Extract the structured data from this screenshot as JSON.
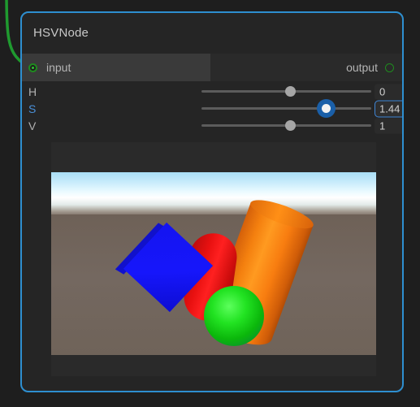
{
  "node": {
    "title": "HSVNode",
    "border_color": "#2e8fd0",
    "background": "#252525",
    "ports": {
      "input": {
        "label": "input",
        "icon": "port-filled-icon",
        "color": "#1f8a1f",
        "connected": true
      },
      "output": {
        "label": "output",
        "icon": "port-hollow-icon",
        "color": "#1f8a1f",
        "connected": false
      }
    },
    "parameters": [
      {
        "key": "H",
        "label": "H",
        "value": "0",
        "slider_pct": 50,
        "focused": false
      },
      {
        "key": "S",
        "label": "S",
        "value": "1.44",
        "slider_pct": 72,
        "focused": true
      },
      {
        "key": "V",
        "label": "V",
        "value": "1",
        "slider_pct": 50,
        "focused": false
      }
    ],
    "accent_focus_color": "#3f86d6",
    "active_label_color": "#4a90d9"
  },
  "wire": {
    "color": "#1f9a2f",
    "from": "offscreen-top-left",
    "to": "input-port"
  },
  "preview": {
    "name": "render-preview",
    "scene": {
      "sky_top_color": "#a9def6",
      "sky_horizon_color": "#ffffff",
      "ground_color": "#6f6258",
      "objects": [
        {
          "name": "blue-cube",
          "color": "#1616fb"
        },
        {
          "name": "red-capsule",
          "color": "#e81010"
        },
        {
          "name": "orange-cylinder",
          "color": "#f4800f"
        },
        {
          "name": "green-sphere",
          "color": "#22e322"
        }
      ]
    }
  },
  "canvas": {
    "background": "#1e1e1e"
  }
}
